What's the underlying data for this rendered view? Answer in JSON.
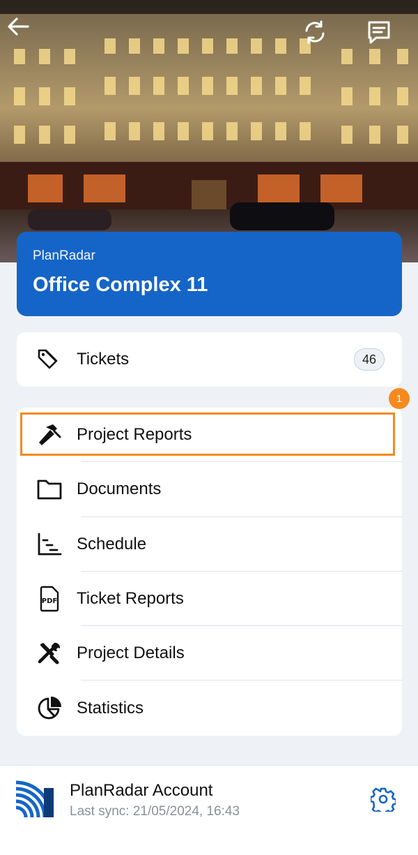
{
  "header": {
    "back_icon": "arrow-left-icon",
    "sync_icon": "refresh-icon",
    "chat_icon": "chat-icon"
  },
  "project": {
    "organization": "PlanRadar",
    "name": "Office Complex 11",
    "accent_color": "#1565c8"
  },
  "tickets": {
    "label": "Tickets",
    "count": "46",
    "icon": "tag-icon"
  },
  "notification_badge": "1",
  "menu": {
    "items": [
      {
        "label": "Project Reports",
        "icon": "hammer-icon",
        "highlighted": true
      },
      {
        "label": "Documents",
        "icon": "folder-icon"
      },
      {
        "label": "Schedule",
        "icon": "gantt-icon"
      },
      {
        "label": "Ticket Reports",
        "icon": "pdf-icon"
      },
      {
        "label": "Project Details",
        "icon": "tools-icon"
      },
      {
        "label": "Statistics",
        "icon": "pie-chart-icon"
      }
    ]
  },
  "footer": {
    "account_title": "PlanRadar Account",
    "last_sync": "Last sync: 21/05/2024, 16:43",
    "settings_icon": "gear-icon"
  }
}
